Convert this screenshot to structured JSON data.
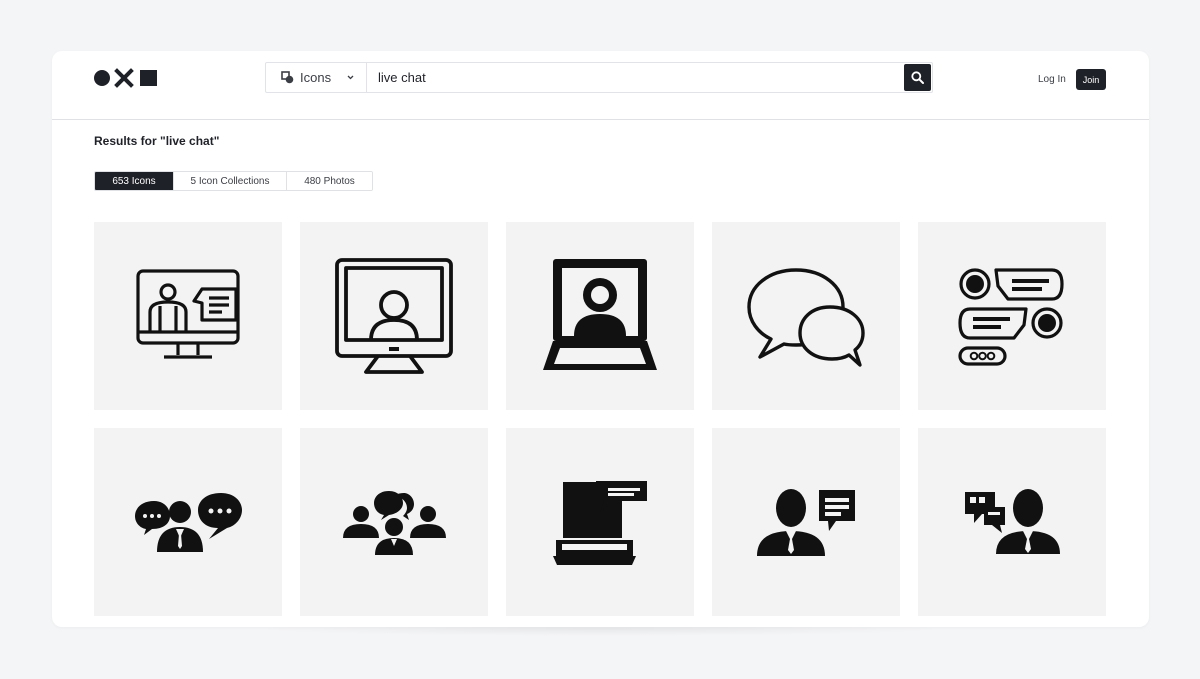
{
  "header": {
    "logo_icons": [
      "circle-icon",
      "x-icon",
      "square-icon"
    ],
    "search": {
      "type_label": "Icons",
      "query": "live chat"
    },
    "login_label": "Log In",
    "join_label": "Join"
  },
  "results": {
    "title": "Results for \"live chat\"",
    "tabs": [
      {
        "label": "653 Icons",
        "active": true
      },
      {
        "label": "5 Icon Collections",
        "active": false
      },
      {
        "label": "480 Photos",
        "active": false
      }
    ]
  },
  "icons": [
    {
      "name": "video-presentation-icon"
    },
    {
      "name": "monitor-user-icon"
    },
    {
      "name": "laptop-user-icon"
    },
    {
      "name": "speech-bubbles-icon"
    },
    {
      "name": "chat-messages-icon"
    },
    {
      "name": "people-conversation-icon"
    },
    {
      "name": "group-chat-icon"
    },
    {
      "name": "laptop-message-icon"
    },
    {
      "name": "user-message-icon"
    },
    {
      "name": "user-chat-icon"
    }
  ],
  "colors": {
    "background": "#f4f5f7",
    "card": "#ffffff",
    "dark": "#1f2128",
    "tile": "#f3f3f4"
  }
}
